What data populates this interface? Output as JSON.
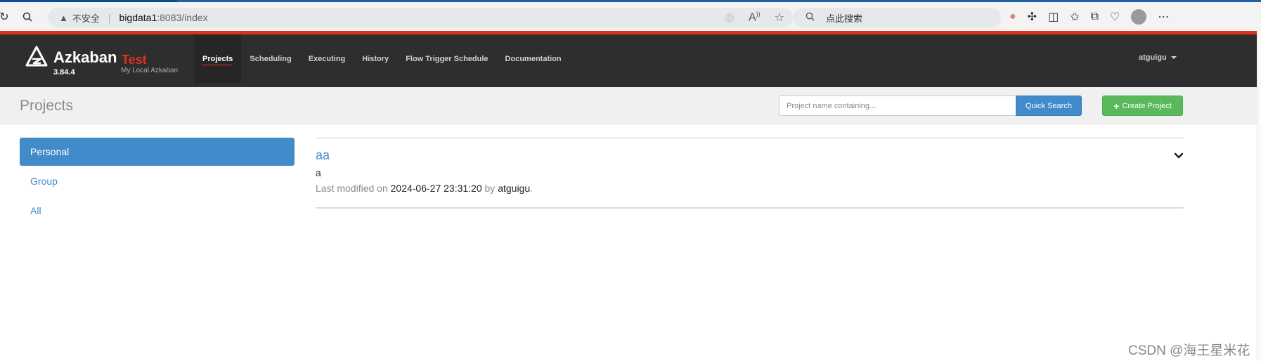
{
  "browser": {
    "security_label": "不安全",
    "url_host": "bigdata1",
    "url_path": ":8083/index",
    "search_placeholder": "点此搜索"
  },
  "header": {
    "brand": "Azkaban",
    "brand_tag": "Test",
    "version": "3.84.4",
    "subtitle": "My Local Azkaban",
    "nav": [
      {
        "label": "Projects",
        "active": true
      },
      {
        "label": "Scheduling"
      },
      {
        "label": "Executing"
      },
      {
        "label": "History"
      },
      {
        "label": "Flow Trigger Schedule"
      },
      {
        "label": "Documentation"
      }
    ],
    "user": "atguigu"
  },
  "page": {
    "title": "Projects",
    "search_placeholder": "Project name containing...",
    "quick_search_label": "Quick Search",
    "create_label": "Create Project"
  },
  "sidebar": {
    "items": [
      {
        "label": "Personal",
        "active": true
      },
      {
        "label": "Group"
      },
      {
        "label": "All"
      }
    ]
  },
  "projects": [
    {
      "name": "aa",
      "description": "a",
      "modified_prefix": "Last modified on",
      "modified_time": "2024-06-27 23:31:20",
      "by_word": "by",
      "modified_by": "atguigu",
      "trailing": "."
    }
  ],
  "watermark": "CSDN @海王星米花",
  "colors": {
    "accent_blue": "#428bca",
    "brand_red": "#e4301e",
    "header_bg": "#2e2e2e",
    "success_green": "#5cb85c"
  }
}
